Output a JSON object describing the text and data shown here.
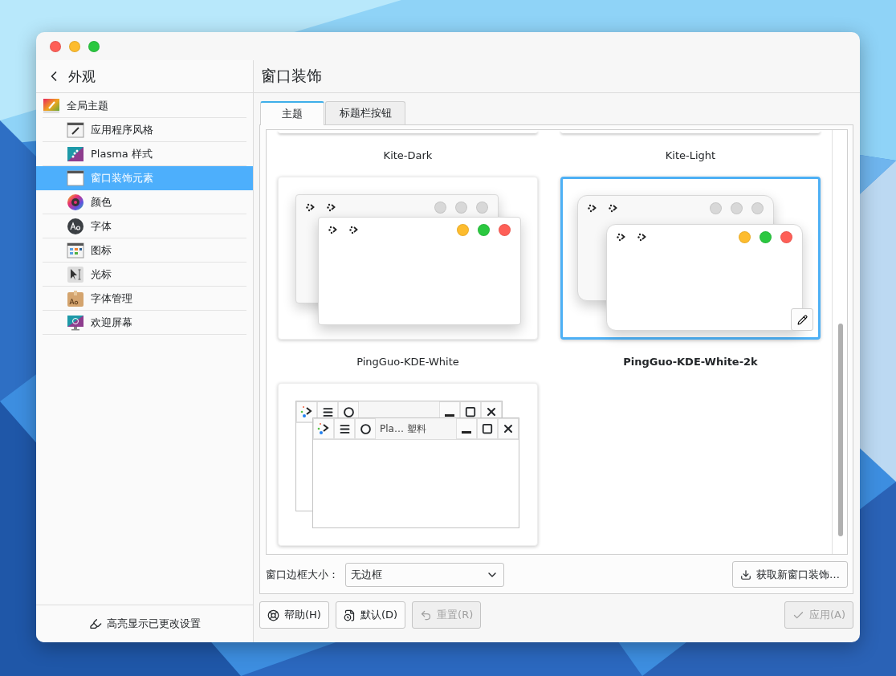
{
  "sidebar": {
    "title": "外观",
    "items": [
      {
        "label": "全局主题",
        "kind": "global",
        "selected": false,
        "children": [
          {
            "label": "应用程序风格",
            "kind": "app-style",
            "selected": false
          },
          {
            "label": "Plasma 样式",
            "kind": "plasma",
            "selected": false
          },
          {
            "label": "窗口装饰元素",
            "kind": "window",
            "selected": true
          },
          {
            "label": "颜色",
            "kind": "colors",
            "selected": false
          },
          {
            "label": "字体",
            "kind": "fonts",
            "selected": false
          },
          {
            "label": "图标",
            "kind": "icons",
            "selected": false
          },
          {
            "label": "光标",
            "kind": "cursor",
            "selected": false
          },
          {
            "label": "字体管理",
            "kind": "font-manager",
            "selected": false
          },
          {
            "label": "欢迎屏幕",
            "kind": "splash",
            "selected": false
          }
        ]
      }
    ],
    "footer_button": "高亮显示已更改设置"
  },
  "page": {
    "title": "窗口装饰",
    "tabs": [
      {
        "label": "主题",
        "selected": true
      },
      {
        "label": "标题栏按钮",
        "selected": false
      }
    ],
    "themes": [
      {
        "name": "Kite-Dark",
        "kind": "cut",
        "selected": false
      },
      {
        "name": "Kite-Light",
        "kind": "cut",
        "selected": false
      },
      {
        "name": "PingGuo-KDE-White",
        "kind": "mac",
        "selected": false
      },
      {
        "name": "PingGuo-KDE-White-2k",
        "kind": "mac",
        "selected": true
      },
      {
        "kind": "plastic",
        "selected": false,
        "preview_title": "Pla… 塑料"
      }
    ],
    "border_size": {
      "label": "窗口边框大小：",
      "value": "无边框"
    },
    "get_new_button": "获取新窗口装饰…",
    "buttons": [
      {
        "label": "帮助(H)",
        "kind": "help",
        "disabled": false
      },
      {
        "label": "默认(D)",
        "kind": "defaults",
        "disabled": false
      },
      {
        "label": "重置(R)",
        "kind": "reset",
        "disabled": true
      },
      {
        "label": "应用(A)",
        "kind": "apply",
        "disabled": true
      }
    ]
  }
}
